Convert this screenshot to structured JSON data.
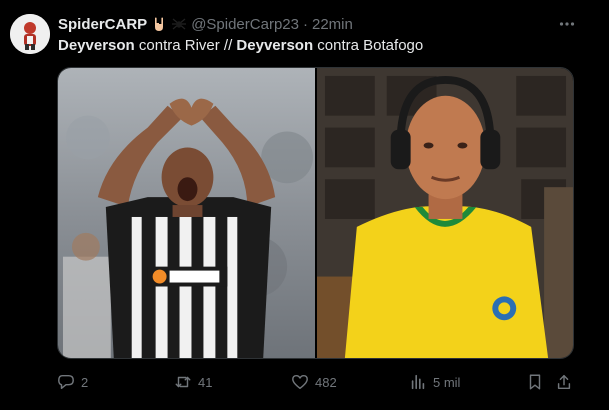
{
  "tweet": {
    "author_name": "SpiderCARP",
    "handle": "@SpiderCarp23",
    "separator": "·",
    "time": "22min",
    "text_parts": [
      "Deyverson",
      " contra River // ",
      "Deyverson",
      " contra Botafogo"
    ],
    "media": [
      {
        "icon": "photo-soccer-player-celebrating"
      },
      {
        "icon": "photo-elderly-man-with-headphones"
      }
    ],
    "actions": {
      "replies": "2",
      "reposts": "41",
      "likes": "482",
      "views": "5 mil"
    }
  },
  "colors": {
    "background": "#000000",
    "text": "#e7e9ea",
    "muted": "#71767b",
    "border": "#2f3336"
  }
}
